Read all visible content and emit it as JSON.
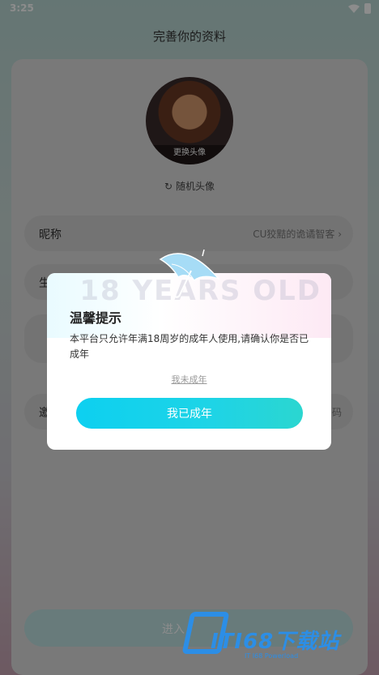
{
  "status_bar": {
    "time": "3:25"
  },
  "page": {
    "title": "完善你的资料"
  },
  "profile": {
    "change_avatar_label": "更换头像",
    "random_avatar_label": "随机头像",
    "nickname_label": "昵称",
    "nickname_value": "CU狡黠的诡谲智客",
    "row2_label_fragment": "生",
    "row4_label_fragment": "邀",
    "row4_value_fragment": "码",
    "bottom_button_fragment": "进入"
  },
  "dialog": {
    "banner_text": "18 YEARS OLD",
    "title": "温馨提示",
    "message": "本平台只允许年满18周岁的成年人使用,请确认你是否已成年",
    "not_adult_label": "我未成年",
    "adult_button_label": "我已成年"
  },
  "watermark": {
    "title": "ITI68下载站",
    "subtitle": "IT I68 Powerload"
  },
  "colors": {
    "accent": "#0dd0f0",
    "watermark": "#2c8ee6"
  }
}
